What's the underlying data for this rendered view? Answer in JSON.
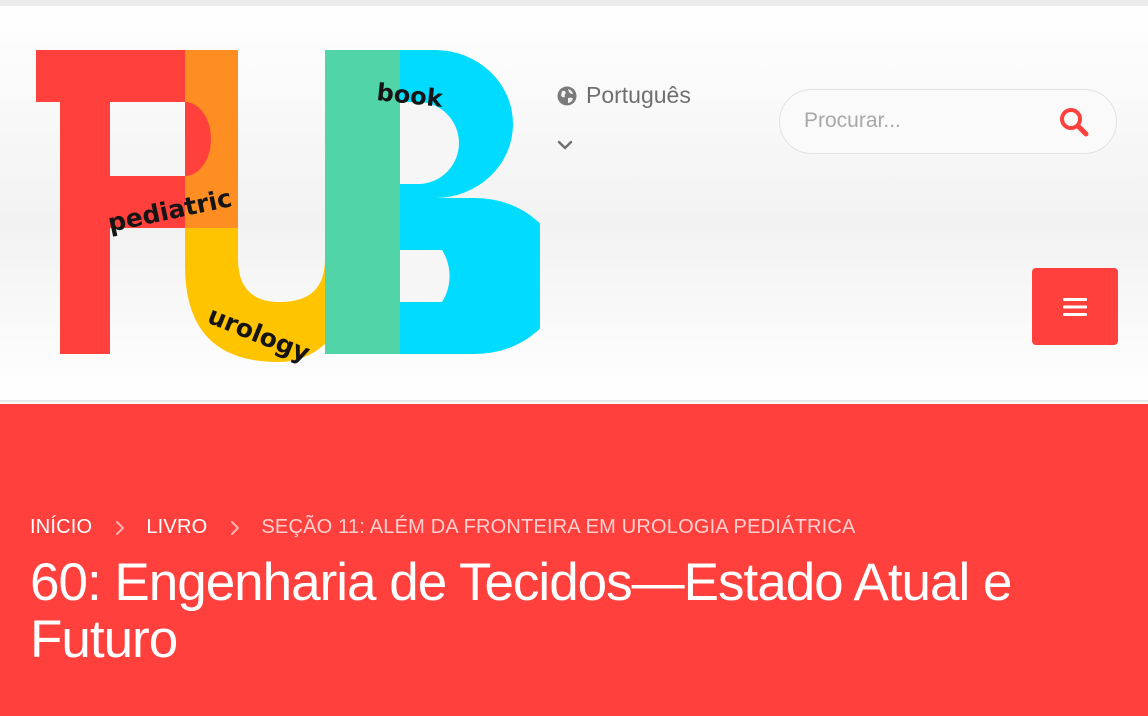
{
  "logo": {
    "letters": "PUB",
    "words": {
      "pediatric": "pediatric",
      "urology": "urology",
      "book": "book"
    },
    "colors": {
      "red": "#ff403d",
      "orange": "#ff8e22",
      "yellow": "#ffc400",
      "green": "#52d4a9",
      "cyan": "#00dbff"
    }
  },
  "language": {
    "label": "Português",
    "icon": "globe-icon"
  },
  "search": {
    "placeholder": "Procurar...",
    "icon": "search-icon"
  },
  "menu": {
    "icon": "hamburger-icon"
  },
  "breadcrumb": {
    "items": [
      "INÍCIO",
      "LIVRO"
    ],
    "current": "SEÇÃO 11: ALÉM DA FRONTEIRA EM UROLOGIA PEDIÁTRICA"
  },
  "page": {
    "title": "60: Engenharia de Tecidos—Estado Atual e Futuro"
  },
  "colors": {
    "accent": "#ff403d",
    "header_bg": "#f2f2f2",
    "text_muted": "#6f6f6f"
  }
}
